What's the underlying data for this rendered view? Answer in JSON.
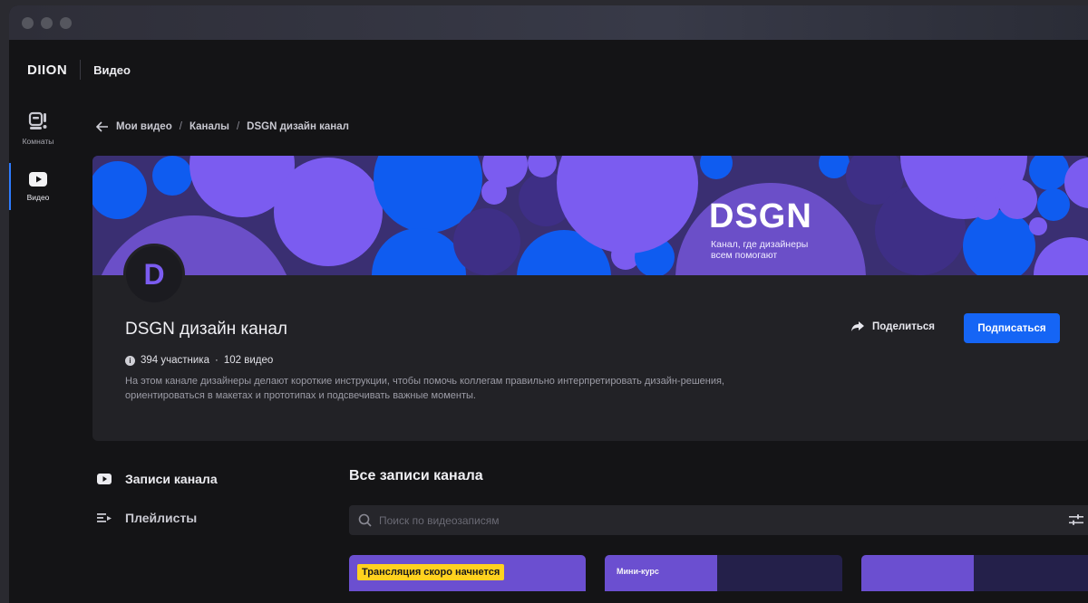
{
  "app": {
    "logo": "DIION",
    "section": "Видео"
  },
  "sidebar": {
    "items": [
      {
        "label": "Комнаты",
        "icon": "rooms-icon"
      },
      {
        "label": "Видео",
        "icon": "video-icon",
        "active": true
      }
    ]
  },
  "breadcrumb": [
    "Мои видео",
    "Каналы",
    "DSGN дизайн канал"
  ],
  "channel": {
    "banner_title": "DSGN",
    "banner_subtitle_line1": "Канал, где дизайнеры",
    "banner_subtitle_line2": "всем помогают",
    "avatar_letter": "D",
    "name": "DSGN дизайн канал",
    "members": "394 участника",
    "videos": "102 видео",
    "meta_separator": "·",
    "description": "На этом канале дизайнеры делают короткие инструкции, чтобы помочь коллегам правильно интерпретировать дизайн-решения, ориентироваться в макетах и прототипах и подсвечивать важные моменты.",
    "share_label": "Поделиться",
    "subscribe_label": "Подписаться"
  },
  "tabs": [
    {
      "label": "Записи канала",
      "icon": "play-icon"
    },
    {
      "label": "Плейлисты",
      "icon": "playlist-icon"
    }
  ],
  "list": {
    "title": "Все записи канала",
    "search_placeholder": "Поиск по видеозаписям"
  },
  "thumbnails": [
    {
      "badge": "Трансляция скоро начнется"
    },
    {
      "label": "Мини-курс"
    }
  ],
  "colors": {
    "accent": "#1565f5",
    "purple": "#7b5cf0",
    "blue": "#0f5cf0",
    "banner_bg": "#3a2f72"
  }
}
